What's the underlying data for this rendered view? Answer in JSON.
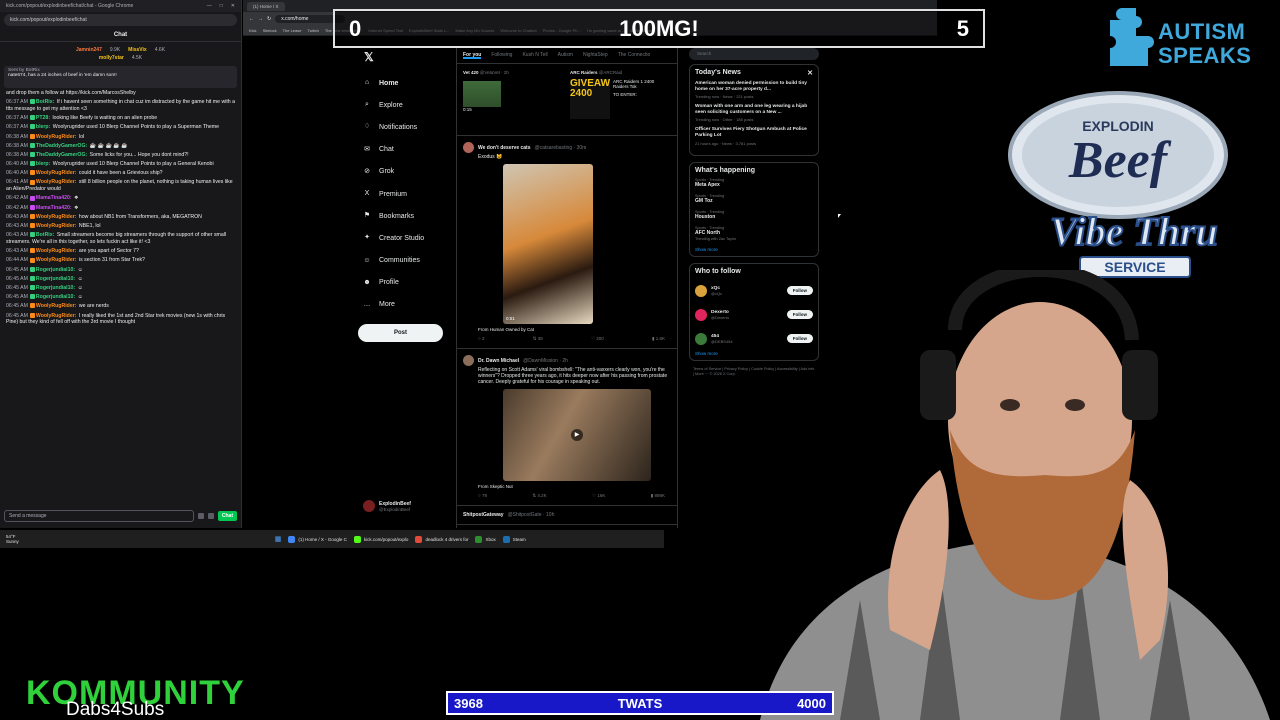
{
  "chat": {
    "window_title": "kick.com/popout/explodinbeef/chat/chat - Google Chrome",
    "url": "kick.com/popout/explodinbeef/chat",
    "header": "Chat",
    "gifters": [
      {
        "name": "Jamnin247",
        "count": "9.9K"
      },
      {
        "name": "MissVix",
        "count": "4.6K"
      },
      {
        "name": "molly7star",
        "count": "4.5K"
      }
    ],
    "pinned_by": "Sent by BotRix",
    "pinned_text": "nate674, has a 24 inches of beef in 'em damn son!!",
    "messages": [
      {
        "ts": "",
        "user": "",
        "color": "#efeff1",
        "text": "and drop them a follow at https://kick.com/MarcosShelby"
      },
      {
        "ts": "06:37 AM",
        "user": "BotRix:",
        "color": "#35d07f",
        "text": "If i havent seen something in chat cuz im distracted by the game hit me with a ttts message to get my attention <3"
      },
      {
        "ts": "06:37 AM",
        "user": "PT28:",
        "color": "#35d07f",
        "text": "looking like Beefy is waiting on an alien probe"
      },
      {
        "ts": "06:37 AM",
        "user": "blerp:",
        "color": "#35d07f",
        "text": "Woolyrugrider used 10 Blerp Channel Points to play a Superman Theme"
      },
      {
        "ts": "06:38 AM",
        "user": "WoolyRugRider:",
        "color": "#ff8c1a",
        "text": "lol"
      },
      {
        "ts": "06:38 AM",
        "user": "TheDaddyGamerOG:",
        "color": "#35d07f",
        "text": "☕ ☕ ☕ ☕ ☕"
      },
      {
        "ts": "06:38 AM",
        "user": "TheDaddyGamerOG:",
        "color": "#35d07f",
        "text": "Some licks for you... Hope you dont mind?!"
      },
      {
        "ts": "06:40 AM",
        "user": "blerp:",
        "color": "#35d07f",
        "text": "Woolyrugrider used 10 Blerp Channel Points to play a General Kenobi"
      },
      {
        "ts": "06:40 AM",
        "user": "WoolyRugRider:",
        "color": "#ff8c1a",
        "text": "could it have been a Grievious ship?"
      },
      {
        "ts": "06:41 AM",
        "user": "WoolyRugRider:",
        "color": "#ff8c1a",
        "text": "still 8 billion people on the planet, nothing is taking human lives like an Alien/Predator would"
      },
      {
        "ts": "06:42 AM",
        "user": "MamaTina420:",
        "color": "#c84cf0",
        "text": "❖"
      },
      {
        "ts": "06:42 AM",
        "user": "MamaTina420:",
        "color": "#c84cf0",
        "text": "❖"
      },
      {
        "ts": "06:43 AM",
        "user": "WoolyRugRider:",
        "color": "#ff8c1a",
        "text": "how about NB1 from Transformers, aka, MEGATRON"
      },
      {
        "ts": "06:43 AM",
        "user": "WoolyRugRider:",
        "color": "#ff8c1a",
        "text": "NBE1, lol"
      },
      {
        "ts": "06:43 AM",
        "user": "BotRix:",
        "color": "#35d07f",
        "text": "Small streamers become big streamers through the support of other small streamers. We're all in this together, so lets fuckin act like it! <3"
      },
      {
        "ts": "06:43 AM",
        "user": "WoolyRugRider:",
        "color": "#ff8c1a",
        "text": "are you apart of Sector 7?"
      },
      {
        "ts": "06:44 AM",
        "user": "WoolyRugRider:",
        "color": "#ff8c1a",
        "text": "is section 31 from Star Trek?"
      },
      {
        "ts": "06:45 AM",
        "user": "Rogerjundial10:",
        "color": "#35d07f",
        "text": "☺"
      },
      {
        "ts": "06:45 AM",
        "user": "Rogerjundial10:",
        "color": "#35d07f",
        "text": "☺"
      },
      {
        "ts": "06:45 AM",
        "user": "Rogerjundial10:",
        "color": "#35d07f",
        "text": "☺"
      },
      {
        "ts": "06:45 AM",
        "user": "Rogerjundial10:",
        "color": "#35d07f",
        "text": "☺"
      },
      {
        "ts": "06:45 AM",
        "user": "WoolyRugRider:",
        "color": "#ff8c1a",
        "text": "we are nerds"
      },
      {
        "ts": "06:45 AM",
        "user": "WoolyRugRider:",
        "color": "#ff8c1a",
        "text": "I really liked the 1st and 2nd Star trek movies (new 1s with chris Pine) but they kind of fell off with the 3rd movie I thought"
      }
    ],
    "input_placeholder": "Send a message",
    "send_label": "Chat"
  },
  "browser": {
    "tab_title": "(1) Home / X",
    "url": "x.com/home",
    "bookmarks": [
      "Kick",
      "Sitelock",
      "The Lease",
      "Twitch",
      "The best streaming...",
      "Internet Speed Test",
      "ExplodinBeef Stats L...",
      "Make Any Mo Sounds",
      "Welcome to Chatbot",
      "Photos - Google Ph...",
      "I'm gaming wave w...",
      "All Bookmarks"
    ]
  },
  "x": {
    "nav": [
      {
        "label": "Home",
        "icon": "home-icon",
        "glyph": "⌂"
      },
      {
        "label": "Explore",
        "icon": "search-icon",
        "glyph": "⌕"
      },
      {
        "label": "Notifications",
        "icon": "bell-icon",
        "glyph": "♢"
      },
      {
        "label": "Chat",
        "icon": "chat-icon",
        "glyph": "✉"
      },
      {
        "label": "Grok",
        "icon": "grok-icon",
        "glyph": "⊘"
      },
      {
        "label": "Premium",
        "icon": "x-icon",
        "glyph": "X"
      },
      {
        "label": "Bookmarks",
        "icon": "bookmark-icon",
        "glyph": "⚑"
      },
      {
        "label": "Creator Studio",
        "icon": "studio-icon",
        "glyph": "✦"
      },
      {
        "label": "Communities",
        "icon": "communities-icon",
        "glyph": "☺"
      },
      {
        "label": "Profile",
        "icon": "profile-icon",
        "glyph": "☻"
      },
      {
        "label": "More",
        "icon": "more-icon",
        "glyph": "…"
      }
    ],
    "post_button": "Post",
    "account_name": "ExplodinBeef",
    "account_handle": "@ExplodinBeef",
    "feed_tabs": [
      "For you",
      "Following",
      "Kush N Tell",
      "Autism",
      "NightaStep",
      "The Connectio"
    ],
    "cards": [
      {
        "name": "Vet 420",
        "handle": "@VetaVet · 2h",
        "duration": "0:15"
      },
      {
        "name": "ARC Raiders",
        "handle": "@ARCRaid",
        "big": "GIVEAW 2400",
        "text": "ARC Raiders 1 2400 Raiders Tok",
        "cta": "TO ENTER:"
      }
    ],
    "posts": [
      {
        "name": "We don't deserve cats",
        "handle": "@catsarebasting · 30m",
        "text": "Exodus 😺",
        "duration": "0:51",
        "from": "From Human Owned by Cat",
        "replies": "2",
        "reposts": "38",
        "likes": "200",
        "views": "1.6K"
      },
      {
        "name": "Dr. Dawn Michael",
        "handle": "@DawnMission · 2h",
        "text": "Reflecting on Scott Adams' viral bombshell: \"The anti-vaxxers clearly won, you're the winners\"? Dropped three years ago, it hits deeper now after his passing from prostate cancer. Deeply grateful for his courage in speaking out.",
        "from": "From Skeptic Nut",
        "replies": "79",
        "reposts": "4.2K",
        "likes": "16K",
        "views": "898K"
      }
    ],
    "next_post_name": "ShitpostGateway",
    "next_post_handle": "@ShitpostGate · 10h",
    "search_placeholder": "Search",
    "todays_news_title": "Today's News",
    "news": [
      {
        "headline": "American woman denied permission to build tiny home on her 37-acre property d...",
        "meta": "Trending now · News · 221 posts"
      },
      {
        "headline": "Woman with one arm and one leg wearing a hijab seen soliciting customers on a New ...",
        "meta": "Trending now · Other · 185 posts"
      },
      {
        "headline": "Officer Survives Fiery Shotgun Ambush at Police Parking Lot",
        "meta": "21 hours ago · News · 3,781 posts"
      }
    ],
    "happening_title": "What's happening",
    "trends": [
      {
        "cat": "Sports · Trending",
        "name": "Meta Apex"
      },
      {
        "cat": "Sports · Trending",
        "name": "GM Toz"
      },
      {
        "cat": "Sports · Trending",
        "name": "Houston"
      },
      {
        "cat": "Sports · Trending",
        "name": "AFC North",
        "sub": "Trending with Zac Taylor"
      }
    ],
    "show_more": "Show more",
    "who_to_follow_title": "Who to follow",
    "follow_suggestions": [
      {
        "name": "xQc",
        "handle": "@xQc",
        "color": "#d9a23a"
      },
      {
        "name": "Dexerto",
        "handle": "@Dexerto",
        "color": "#e0245e"
      },
      {
        "name": "454",
        "handle": "@DEBS454",
        "color": "#3a7a3a"
      }
    ],
    "follow_label": "Follow",
    "footer": "Terms of Service | Privacy Policy | Cookie Policy | Accessibility | Ads info | More ··· © 2026 X Corp."
  },
  "taskbar": {
    "temp": "54°F",
    "condition": "Sunny",
    "apps": [
      {
        "label": "(1) Home / X - Google C",
        "color": "#4285f4"
      },
      {
        "label": "kick.com/popout/explo",
        "color": "#53fc18"
      },
      {
        "label": "deadlock 4 drivers for",
        "color": "#e04b3a"
      },
      {
        "label": "Xbox",
        "color": "#2d8f2d"
      },
      {
        "label": "Steam",
        "color": "#1b6fb0"
      }
    ]
  },
  "overlay": {
    "counter_left": "0",
    "counter_title": "100MG!",
    "counter_right": "5",
    "autism_logo_text": "AUTISM SPEAKS",
    "autism_line1": "AUTISM",
    "autism_line2": "SPEAKS",
    "beef_logo": {
      "top": "EXPLODIN",
      "main": "Beef",
      "sub": "Vibe Thru",
      "service": "SERVICE"
    },
    "kommunity": "KOMMUNITY",
    "dabs": "Dabs4Subs",
    "goal_current": "3968",
    "goal_label": "TWATS",
    "goal_target": "4000",
    "goal_progress": 0.992
  },
  "colors": {
    "x_accent": "#1d9bf0",
    "kick_green": "#53fc18",
    "goal_blue": "#1818c8",
    "autism_blue": "#3fa9dc"
  }
}
